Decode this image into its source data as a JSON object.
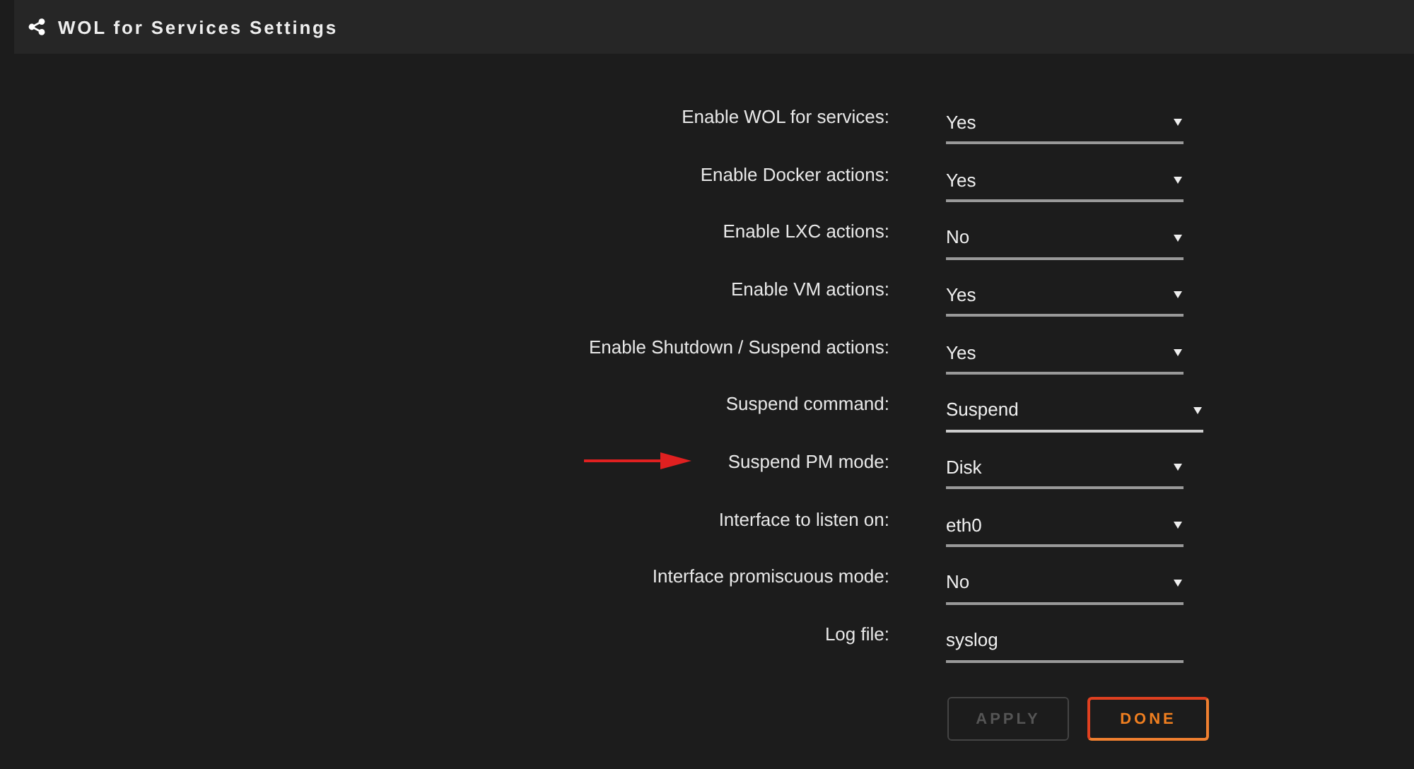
{
  "header": {
    "title": "WOL for Services Settings"
  },
  "settings": [
    {
      "label": "Enable WOL for services:",
      "kind": "select",
      "value": "Yes",
      "wide": false,
      "arrow": false
    },
    {
      "label": "Enable Docker actions:",
      "kind": "select",
      "value": "Yes",
      "wide": false,
      "arrow": false
    },
    {
      "label": "Enable LXC actions:",
      "kind": "select",
      "value": "No",
      "wide": false,
      "arrow": false
    },
    {
      "label": "Enable VM actions:",
      "kind": "select",
      "value": "Yes",
      "wide": false,
      "arrow": false
    },
    {
      "label": "Enable Shutdown / Suspend actions:",
      "kind": "select",
      "value": "Yes",
      "wide": false,
      "arrow": false
    },
    {
      "label": "Suspend command:",
      "kind": "select",
      "value": "Suspend",
      "wide": true,
      "arrow": false
    },
    {
      "label": "Suspend PM mode:",
      "kind": "select",
      "value": "Disk",
      "wide": false,
      "arrow": true
    },
    {
      "label": "Interface to listen on:",
      "kind": "select",
      "value": "eth0",
      "wide": false,
      "arrow": false
    },
    {
      "label": "Interface promiscuous mode:",
      "kind": "select",
      "value": "No",
      "wide": false,
      "arrow": false
    },
    {
      "label": "Log file:",
      "kind": "text",
      "value": "syslog",
      "wide": false,
      "arrow": false
    }
  ],
  "buttons": [
    {
      "label": "APPLY",
      "disabled": true
    },
    {
      "label": "DONE",
      "disabled": false
    }
  ]
}
